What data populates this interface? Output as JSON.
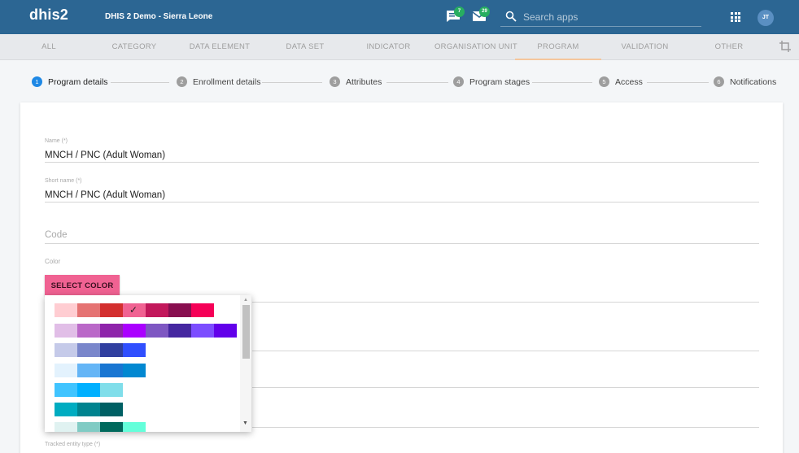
{
  "header": {
    "logo": "dhis2",
    "instance_name": "DHIS 2 Demo - Sierra Leone",
    "interpretations_count": "7",
    "messages_count": "29",
    "search_placeholder": "Search apps",
    "user_initials": "JT",
    "icons": [
      "interpretations-icon",
      "messages-icon",
      "search-icon",
      "apps-grid-icon"
    ]
  },
  "tabs": [
    {
      "label": "ALL",
      "active": false
    },
    {
      "label": "CATEGORY",
      "active": false
    },
    {
      "label": "DATA ELEMENT",
      "active": false
    },
    {
      "label": "DATA SET",
      "active": false
    },
    {
      "label": "INDICATOR",
      "active": false
    },
    {
      "label": "ORGANISATION UNIT",
      "active": false
    },
    {
      "label": "PROGRAM",
      "active": true
    },
    {
      "label": "VALIDATION",
      "active": false
    },
    {
      "label": "OTHER",
      "active": false
    }
  ],
  "steps": [
    {
      "num": "1",
      "label": "Program details",
      "active": true
    },
    {
      "num": "2",
      "label": "Enrollment details",
      "active": false
    },
    {
      "num": "3",
      "label": "Attributes",
      "active": false
    },
    {
      "num": "4",
      "label": "Program stages",
      "active": false
    },
    {
      "num": "5",
      "label": "Access",
      "active": false
    },
    {
      "num": "6",
      "label": "Notifications",
      "active": false
    }
  ],
  "form": {
    "name_label": "Name (*)",
    "name_value": "MNCH / PNC (Adult Woman)",
    "short_name_label": "Short name (*)",
    "short_name_value": "MNCH / PNC (Adult Woman)",
    "code_placeholder": "Code",
    "color_label": "Color",
    "select_color_button": "SELECT COLOR",
    "tracked_entity_type_label": "Tracked entity type (*)"
  },
  "color_palette": {
    "selected": "#f06292",
    "rows": [
      [
        "#ffcdd2",
        "#e57373",
        "#d32f2f",
        "#f06292",
        "#c2185b",
        "#880e4f",
        "#f50057"
      ],
      [
        "#e1bee7",
        "#ba68c8",
        "#8e24aa",
        "#aa00ff",
        "#7e57c2",
        "#4527a0",
        "#7c4dff",
        "#6200ea"
      ],
      [
        "#c5cae9",
        "#7986cb",
        "#303f9f",
        "#304ffe"
      ],
      [
        "#e3f2fd",
        "#64b5f6",
        "#1976d2",
        "#0288d1"
      ],
      [
        "#40c4ff",
        "#00b0ff",
        "#80deea"
      ],
      [
        "#00acc1",
        "#00838f",
        "#006064"
      ],
      [
        "#e0f2f1",
        "#80cbc4",
        "#00695c",
        "#64ffda"
      ]
    ]
  }
}
